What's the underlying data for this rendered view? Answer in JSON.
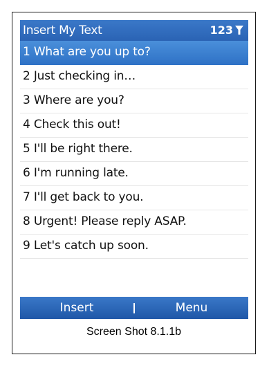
{
  "title_bar": {
    "title": "Insert My Text",
    "input_mode": "123",
    "input_mode_icon": "filter-icon"
  },
  "list": {
    "items": [
      {
        "label": "1 What are you up to?",
        "selected": true
      },
      {
        "label": "2 Just checking in…",
        "selected": false
      },
      {
        "label": "3 Where are you?",
        "selected": false
      },
      {
        "label": "4 Check this out!",
        "selected": false
      },
      {
        "label": "5 I'll be right there.",
        "selected": false
      },
      {
        "label": "6 I'm running late.",
        "selected": false
      },
      {
        "label": "7 I'll get back to you.",
        "selected": false
      },
      {
        "label": "8 Urgent! Please reply ASAP.",
        "selected": false
      },
      {
        "label": "9 Let's catch up soon.",
        "selected": false
      }
    ]
  },
  "softkeys": {
    "left": "Insert",
    "right": "Menu"
  },
  "caption": "Screen Shot 8.1.1b",
  "colors": {
    "accent": "#2f72c6",
    "bar": "#2a63b4"
  }
}
